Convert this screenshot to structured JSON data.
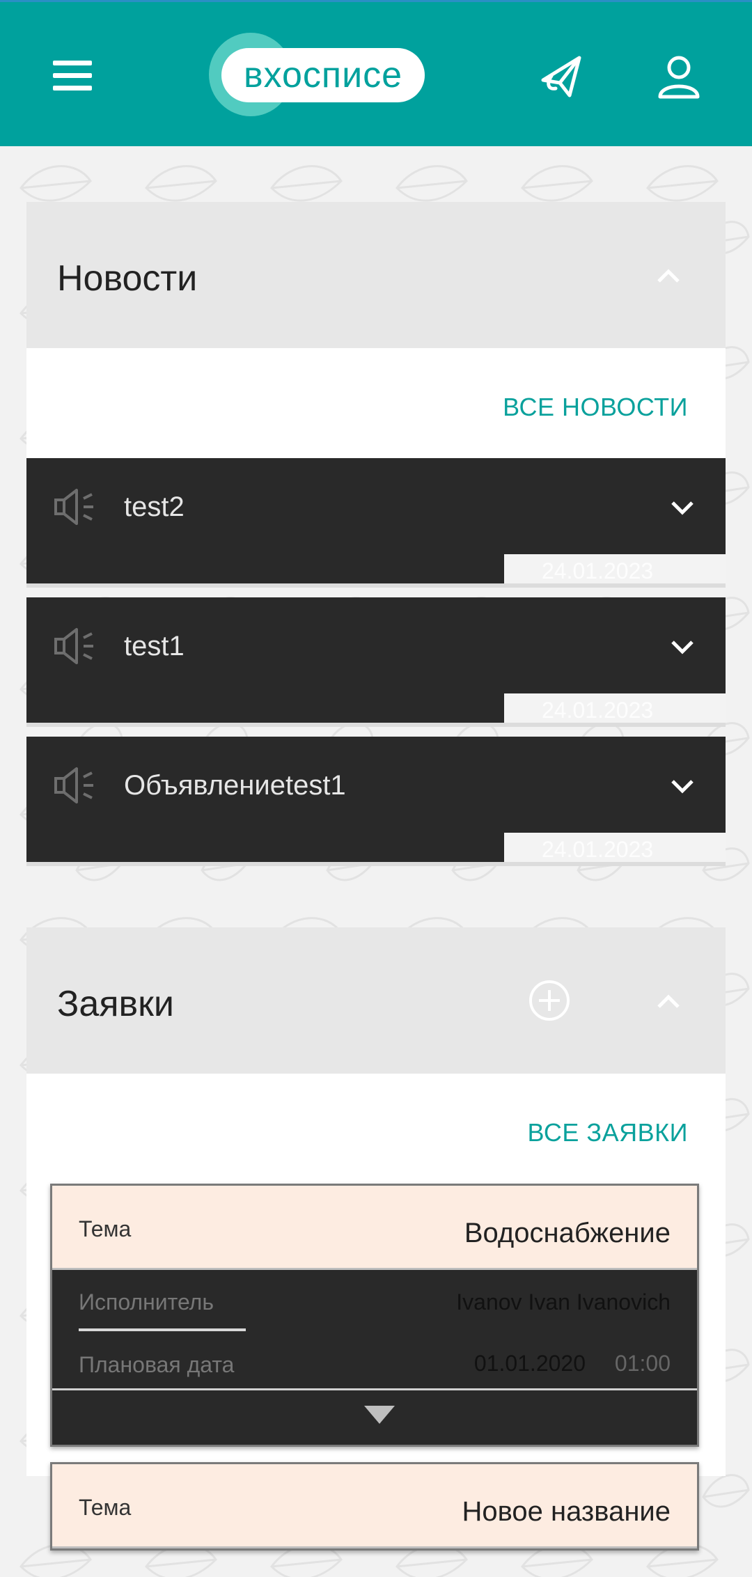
{
  "header": {
    "logo_text": "вхосписе",
    "colors": {
      "bar": "#00a19d",
      "accent_text": "#0aa19c"
    },
    "icons": [
      "menu-icon",
      "paper-plane-icon",
      "user-icon"
    ]
  },
  "news": {
    "title": "Новости",
    "all_link": "ВСЕ НОВОСТИ",
    "items": [
      {
        "title": "test2",
        "date": "24.01.2023"
      },
      {
        "title": "test1",
        "date": "24.01.2023"
      },
      {
        "title": "Объявлениеtest1",
        "date": "24.01.2023"
      }
    ]
  },
  "requests": {
    "title": "Заявки",
    "all_link": "ВСЕ ЗАЯВКИ",
    "items": [
      {
        "theme_label": "Тема",
        "theme": "Водоснабжение",
        "executor_label": "Исполнитель",
        "executor": "Ivanov Ivan Ivanovich",
        "planned_date_label": "Плановая дата",
        "planned_date": "01.01.2020",
        "planned_time": "01:00"
      },
      {
        "theme_label": "Тема",
        "theme": "Новое название"
      }
    ]
  }
}
